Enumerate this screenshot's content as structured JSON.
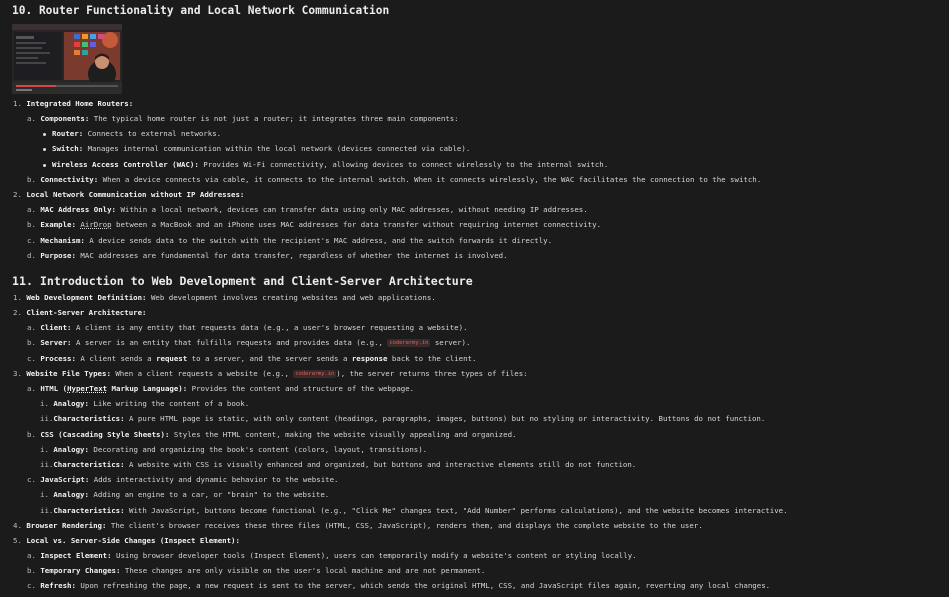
{
  "section10": {
    "title": "10. Router Functionality and Local Network Communication",
    "l1": {
      "m": "1.",
      "t": "Integrated Home Routers:"
    },
    "l2": {
      "m": "a.",
      "t": "Components:",
      "r": " The typical home router is not just a router; it integrates three main components:"
    },
    "l3": {
      "t": "Router:",
      "r": " Connects to external networks."
    },
    "l4": {
      "t": "Switch:",
      "r": " Manages internal communication within the local network (devices connected via cable)."
    },
    "l5": {
      "t": "Wireless Access Controller (WAC):",
      "r": " Provides Wi-Fi connectivity, allowing devices to connect wirelessly to the internal switch."
    },
    "l6": {
      "m": "b.",
      "t": "Connectivity:",
      "r": " When a device connects via cable, it connects to the internal switch. When it connects wirelessly, the WAC facilitates the connection to the switch."
    },
    "l7": {
      "m": "2.",
      "t": "Local Network Communication without IP Addresses:"
    },
    "l8": {
      "m": "a.",
      "t": "MAC Address Only:",
      "r": " Within a local network, devices can transfer data using only MAC addresses, without needing IP addresses."
    },
    "l9": {
      "m": "b.",
      "t": "Example:",
      "r1": " ",
      "u": "AirDrop",
      "r2": " between a MacBook and an iPhone uses MAC addresses for data transfer without requiring internet connectivity."
    },
    "l10": {
      "m": "c.",
      "t": "Mechanism:",
      "r": " A device sends data to the switch with the recipient's MAC address, and the switch forwards it directly."
    },
    "l11": {
      "m": "d.",
      "t": "Purpose:",
      "r": " MAC addresses are fundamental for data transfer, regardless of whether the internet is involved."
    }
  },
  "section11": {
    "title": "11. Introduction to Web Development and Client-Server Architecture",
    "l1": {
      "m": "1.",
      "t": "Web Development Definition:",
      "r": " Web development involves creating websites and web applications."
    },
    "l2": {
      "m": "2.",
      "t": "Client-Server Architecture:"
    },
    "l3": {
      "m": "a.",
      "t": "Client:",
      "r": " A client is any entity that requests data (e.g., a user's browser requesting a website)."
    },
    "l4": {
      "m": "b.",
      "t": "Server:",
      "r1": " A server is an entity that fulfills requests and provides data (e.g., ",
      "code": "coderarmy.in",
      "r2": " server)."
    },
    "l5": {
      "m": "c.",
      "t": "Process:",
      "r1": " A client sends a ",
      "b1": "request",
      "r2": " to a server, and the server sends a ",
      "b2": "response",
      "r3": " back to the client."
    },
    "l6": {
      "m": "3.",
      "t": "Website File Types:",
      "r1": " When a client requests a website (e.g., ",
      "code": "coderarmy.in",
      "r2": "), the server returns three types of files:"
    },
    "l7": {
      "m": "a.",
      "t": "HTML (",
      "u": "HyperText",
      "t2": " Markup Language):",
      "r": " Provides the content and structure of the webpage."
    },
    "l8": {
      "m": "i.",
      "t": "Analogy:",
      "r": " Like writing the content of a book."
    },
    "l9": {
      "m": "ii.",
      "t": "Characteristics:",
      "r": " A pure HTML page is static, with only content (headings, paragraphs, images, buttons) but no styling or interactivity. Buttons do not function."
    },
    "l10": {
      "m": "b.",
      "t": "CSS (Cascading Style Sheets):",
      "r": " Styles the HTML content, making the website visually appealing and organized."
    },
    "l11": {
      "m": "i.",
      "t": "Analogy:",
      "r": " Decorating and organizing the book's content (colors, layout, transitions)."
    },
    "l12": {
      "m": "ii.",
      "t": "Characteristics:",
      "r": " A website with CSS is visually enhanced and organized, but buttons and interactive elements still do not function."
    },
    "l13": {
      "m": "c.",
      "t": "JavaScript:",
      "r": " Adds interactivity and dynamic behavior to the website."
    },
    "l14": {
      "m": "i.",
      "t": "Analogy:",
      "r": " Adding an engine to a car, or \"brain\" to the website."
    },
    "l15": {
      "m": "ii.",
      "t": "Characteristics:",
      "r": " With JavaScript, buttons become functional (e.g., \"Click Me\" changes text, \"Add Number\" performs calculations), and the website becomes interactive."
    },
    "l16": {
      "m": "4.",
      "t": "Browser Rendering:",
      "r": " The client's browser receives these three files (HTML, CSS, JavaScript), renders them, and displays the complete website to the user."
    },
    "l17": {
      "m": "5.",
      "t": "Local vs. Server-Side Changes (Inspect Element):"
    },
    "l18": {
      "m": "a.",
      "t": "Inspect Element:",
      "r": " Using browser developer tools (Inspect Element), users can temporarily modify a website's content or styling locally."
    },
    "l19": {
      "m": "b.",
      "t": "Temporary Changes:",
      "r": " These changes are only visible on the user's local machine and are not permanent."
    },
    "l20": {
      "m": "c.",
      "t": "Refresh:",
      "r": " Upon refreshing the page, a new request is sent to the server, which sends the original HTML, CSS, and JavaScript files again, reverting any local changes."
    }
  }
}
